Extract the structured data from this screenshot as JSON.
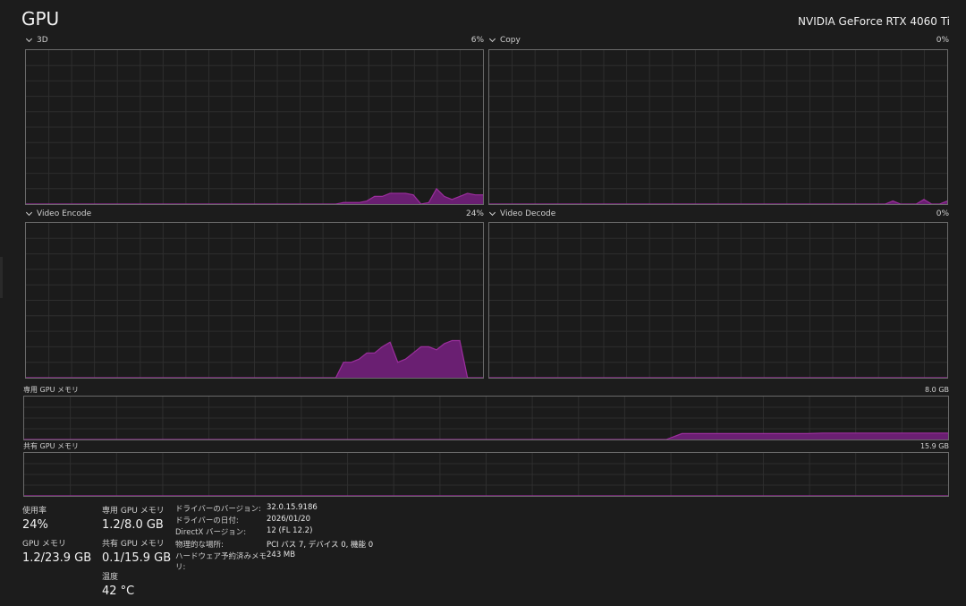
{
  "header": {
    "title": "GPU",
    "device_name": "NVIDIA GeForce RTX 4060 Ti"
  },
  "engines": [
    {
      "label": "3D",
      "value": "6%"
    },
    {
      "label": "Copy",
      "value": "0%"
    },
    {
      "label": "Video Encode",
      "value": "24%"
    },
    {
      "label": "Video Decode",
      "value": "0%"
    }
  ],
  "memory_graphs": [
    {
      "label": "専用 GPU メモリ",
      "capacity": "8.0 GB"
    },
    {
      "label": "共有 GPU メモリ",
      "capacity": "15.9 GB"
    }
  ],
  "stats": {
    "utilization": {
      "label": "使用率",
      "value": "24%"
    },
    "gpu_memory": {
      "label": "GPU メモリ",
      "value": "1.2/23.9 GB"
    },
    "dedicated_memory": {
      "label": "専用 GPU メモリ",
      "value": "1.2/8.0 GB"
    },
    "shared_memory": {
      "label": "共有 GPU メモリ",
      "value": "0.1/15.9 GB"
    },
    "temperature": {
      "label": "温度",
      "value": "42 °C"
    }
  },
  "details": [
    {
      "key": "ドライバーのバージョン:",
      "value": "32.0.15.9186"
    },
    {
      "key": "ドライバーの日付:",
      "value": "2026/01/20"
    },
    {
      "key": "DirectX バージョン:",
      "value": "12 (FL 12.2)"
    },
    {
      "key": "物理的な場所:",
      "value": "PCI バス 7, デバイス 0, 機能 0"
    },
    {
      "key": "ハードウェア予約済みメモリ:",
      "value": "243 MB"
    }
  ],
  "chart_data": [
    {
      "type": "area",
      "y_range": [
        0,
        100
      ],
      "x": [
        0,
        1,
        2,
        3,
        4,
        5,
        6,
        7,
        8,
        9,
        10,
        11,
        12,
        13,
        14,
        15,
        16,
        17,
        18,
        19,
        20,
        21,
        22,
        23,
        24,
        25,
        26,
        27,
        28,
        29,
        30,
        31,
        32,
        33,
        34,
        35,
        36,
        37,
        38,
        39,
        40,
        41,
        42,
        43,
        44,
        45,
        46,
        47,
        48,
        49,
        50,
        51,
        52,
        53,
        54,
        55,
        56,
        57,
        58,
        59
      ],
      "values": [
        0,
        0,
        0,
        0,
        0,
        0,
        0,
        0,
        0,
        0,
        0,
        0,
        0,
        0,
        0,
        0,
        0,
        0,
        0,
        0,
        0,
        0,
        0,
        0,
        0,
        0,
        0,
        0,
        0,
        0,
        0,
        0,
        0,
        0,
        0,
        0,
        0,
        0,
        0,
        0,
        0,
        1,
        1,
        1,
        2,
        5,
        5,
        7,
        7,
        7,
        6,
        0,
        1,
        10,
        5,
        3,
        5,
        7,
        6,
        6
      ]
    },
    {
      "type": "area",
      "y_range": [
        0,
        100
      ],
      "x": [
        0,
        1,
        2,
        3,
        4,
        5,
        6,
        7,
        8,
        9,
        10,
        11,
        12,
        13,
        14,
        15,
        16,
        17,
        18,
        19,
        20,
        21,
        22,
        23,
        24,
        25,
        26,
        27,
        28,
        29,
        30,
        31,
        32,
        33,
        34,
        35,
        36,
        37,
        38,
        39,
        40,
        41,
        42,
        43,
        44,
        45,
        46,
        47,
        48,
        49,
        50,
        51,
        52,
        53,
        54,
        55,
        56,
        57,
        58,
        59
      ],
      "values": [
        0,
        0,
        0,
        0,
        0,
        0,
        0,
        0,
        0,
        0,
        0,
        0,
        0,
        0,
        0,
        0,
        0,
        0,
        0,
        0,
        0,
        0,
        0,
        0,
        0,
        0,
        0,
        0,
        0,
        0,
        0,
        0,
        0,
        0,
        0,
        0,
        0,
        0,
        0,
        0,
        0,
        0,
        0,
        0,
        0,
        0,
        0,
        0,
        0,
        0,
        0,
        0,
        2,
        0,
        0,
        0,
        3,
        0,
        0,
        2
      ]
    },
    {
      "type": "area",
      "y_range": [
        0,
        100
      ],
      "x": [
        0,
        1,
        2,
        3,
        4,
        5,
        6,
        7,
        8,
        9,
        10,
        11,
        12,
        13,
        14,
        15,
        16,
        17,
        18,
        19,
        20,
        21,
        22,
        23,
        24,
        25,
        26,
        27,
        28,
        29,
        30,
        31,
        32,
        33,
        34,
        35,
        36,
        37,
        38,
        39,
        40,
        41,
        42,
        43,
        44,
        45,
        46,
        47,
        48,
        49,
        50,
        51,
        52,
        53,
        54,
        55,
        56,
        57,
        58,
        59
      ],
      "values": [
        0,
        0,
        0,
        0,
        0,
        0,
        0,
        0,
        0,
        0,
        0,
        0,
        0,
        0,
        0,
        0,
        0,
        0,
        0,
        0,
        0,
        0,
        0,
        0,
        0,
        0,
        0,
        0,
        0,
        0,
        0,
        0,
        0,
        0,
        0,
        0,
        0,
        0,
        0,
        0,
        0,
        10,
        10,
        12,
        16,
        16,
        20,
        23,
        10,
        12,
        16,
        20,
        20,
        18,
        22,
        24,
        24,
        0,
        0,
        0
      ]
    },
    {
      "type": "area",
      "y_range": [
        0,
        100
      ],
      "x": [
        0,
        1,
        2,
        3,
        4,
        5,
        6,
        7,
        8,
        9,
        10,
        11,
        12,
        13,
        14,
        15,
        16,
        17,
        18,
        19,
        20,
        21,
        22,
        23,
        24,
        25,
        26,
        27,
        28,
        29,
        30,
        31,
        32,
        33,
        34,
        35,
        36,
        37,
        38,
        39,
        40,
        41,
        42,
        43,
        44,
        45,
        46,
        47,
        48,
        49,
        50,
        51,
        52,
        53,
        54,
        55,
        56,
        57,
        58,
        59
      ],
      "values": [
        0,
        0,
        0,
        0,
        0,
        0,
        0,
        0,
        0,
        0,
        0,
        0,
        0,
        0,
        0,
        0,
        0,
        0,
        0,
        0,
        0,
        0,
        0,
        0,
        0,
        0,
        0,
        0,
        0,
        0,
        0,
        0,
        0,
        0,
        0,
        0,
        0,
        0,
        0,
        0,
        0,
        0,
        0,
        0,
        0,
        0,
        0,
        0,
        0,
        0,
        0,
        0,
        0,
        0,
        0,
        0,
        0,
        0,
        0,
        0
      ]
    },
    {
      "type": "area",
      "y_range": [
        0,
        8.0
      ],
      "x": [
        0,
        1,
        2,
        3,
        4,
        5,
        6,
        7,
        8,
        9,
        10,
        11,
        12,
        13,
        14,
        15,
        16,
        17,
        18,
        19,
        20,
        21,
        22,
        23,
        24,
        25,
        26,
        27,
        28,
        29,
        30,
        31,
        32,
        33,
        34,
        35,
        36,
        37,
        38,
        39,
        40,
        41,
        42,
        43,
        44,
        45,
        46,
        47,
        48,
        49,
        50,
        51,
        52,
        53,
        54,
        55,
        56,
        57,
        58,
        59
      ],
      "values": [
        0,
        0,
        0,
        0,
        0,
        0,
        0,
        0,
        0,
        0,
        0,
        0,
        0,
        0,
        0,
        0,
        0,
        0,
        0,
        0,
        0,
        0,
        0,
        0,
        0,
        0,
        0,
        0,
        0,
        0,
        0,
        0,
        0,
        0,
        0,
        0,
        0,
        0,
        0,
        0,
        0,
        0,
        1.1,
        1.1,
        1.1,
        1.1,
        1.1,
        1.1,
        1.1,
        1.1,
        1.1,
        1.2,
        1.2,
        1.2,
        1.2,
        1.2,
        1.2,
        1.2,
        1.2,
        1.2
      ]
    },
    {
      "type": "area",
      "y_range": [
        0,
        15.9
      ],
      "x": [
        0,
        1,
        2,
        3,
        4,
        5,
        6,
        7,
        8,
        9,
        10,
        11,
        12,
        13,
        14,
        15,
        16,
        17,
        18,
        19,
        20,
        21,
        22,
        23,
        24,
        25,
        26,
        27,
        28,
        29,
        30,
        31,
        32,
        33,
        34,
        35,
        36,
        37,
        38,
        39,
        40,
        41,
        42,
        43,
        44,
        45,
        46,
        47,
        48,
        49,
        50,
        51,
        52,
        53,
        54,
        55,
        56,
        57,
        58,
        59
      ],
      "values": [
        0,
        0,
        0,
        0,
        0,
        0,
        0,
        0,
        0,
        0,
        0,
        0,
        0,
        0,
        0,
        0,
        0,
        0,
        0,
        0,
        0,
        0,
        0,
        0,
        0,
        0,
        0,
        0,
        0,
        0,
        0,
        0,
        0,
        0,
        0,
        0,
        0,
        0,
        0,
        0,
        0,
        0,
        0,
        0,
        0,
        0,
        0,
        0,
        0,
        0,
        0,
        0,
        0,
        0,
        0,
        0,
        0,
        0,
        0,
        0
      ]
    }
  ],
  "colors": {
    "accent": "#9b2e9d",
    "fill": "#6a1f72",
    "border": "#6a6a6a",
    "grid": "#2e2e2e",
    "background": "#1c1c1c"
  }
}
